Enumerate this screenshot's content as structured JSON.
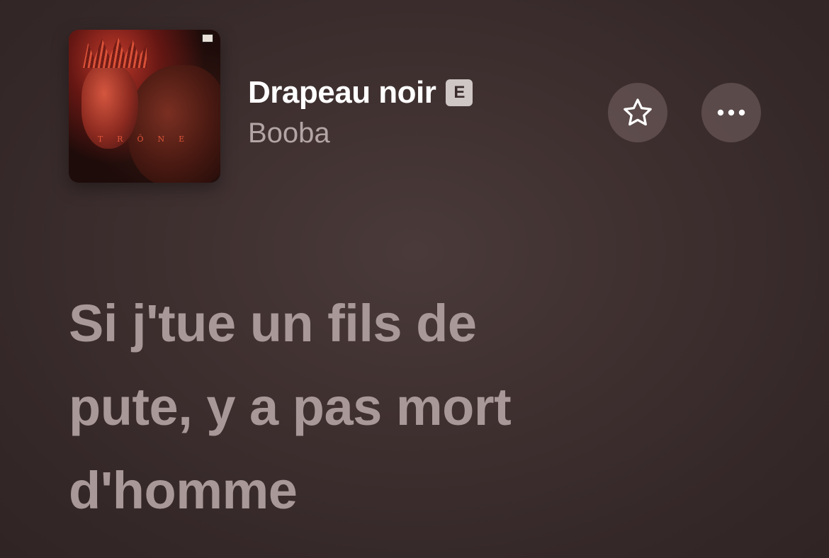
{
  "now_playing": {
    "album_art": {
      "icon": "album-cover",
      "album_word": "TRÔNE",
      "accent_color": "#e0553a"
    },
    "title": "Drapeau noir",
    "explicit_badge": "E",
    "artist": "Booba"
  },
  "actions": {
    "favorite_icon": "star-icon",
    "more_icon": "more-dots-icon"
  },
  "lyrics": {
    "lines": [
      "Si j'tue un fils de",
      "pute, y a pas mort",
      "d'homme"
    ]
  },
  "colors": {
    "background": "#3b2e2e",
    "title": "#ffffff",
    "artist": "#b3a5a5",
    "lyric": "#a89898"
  }
}
